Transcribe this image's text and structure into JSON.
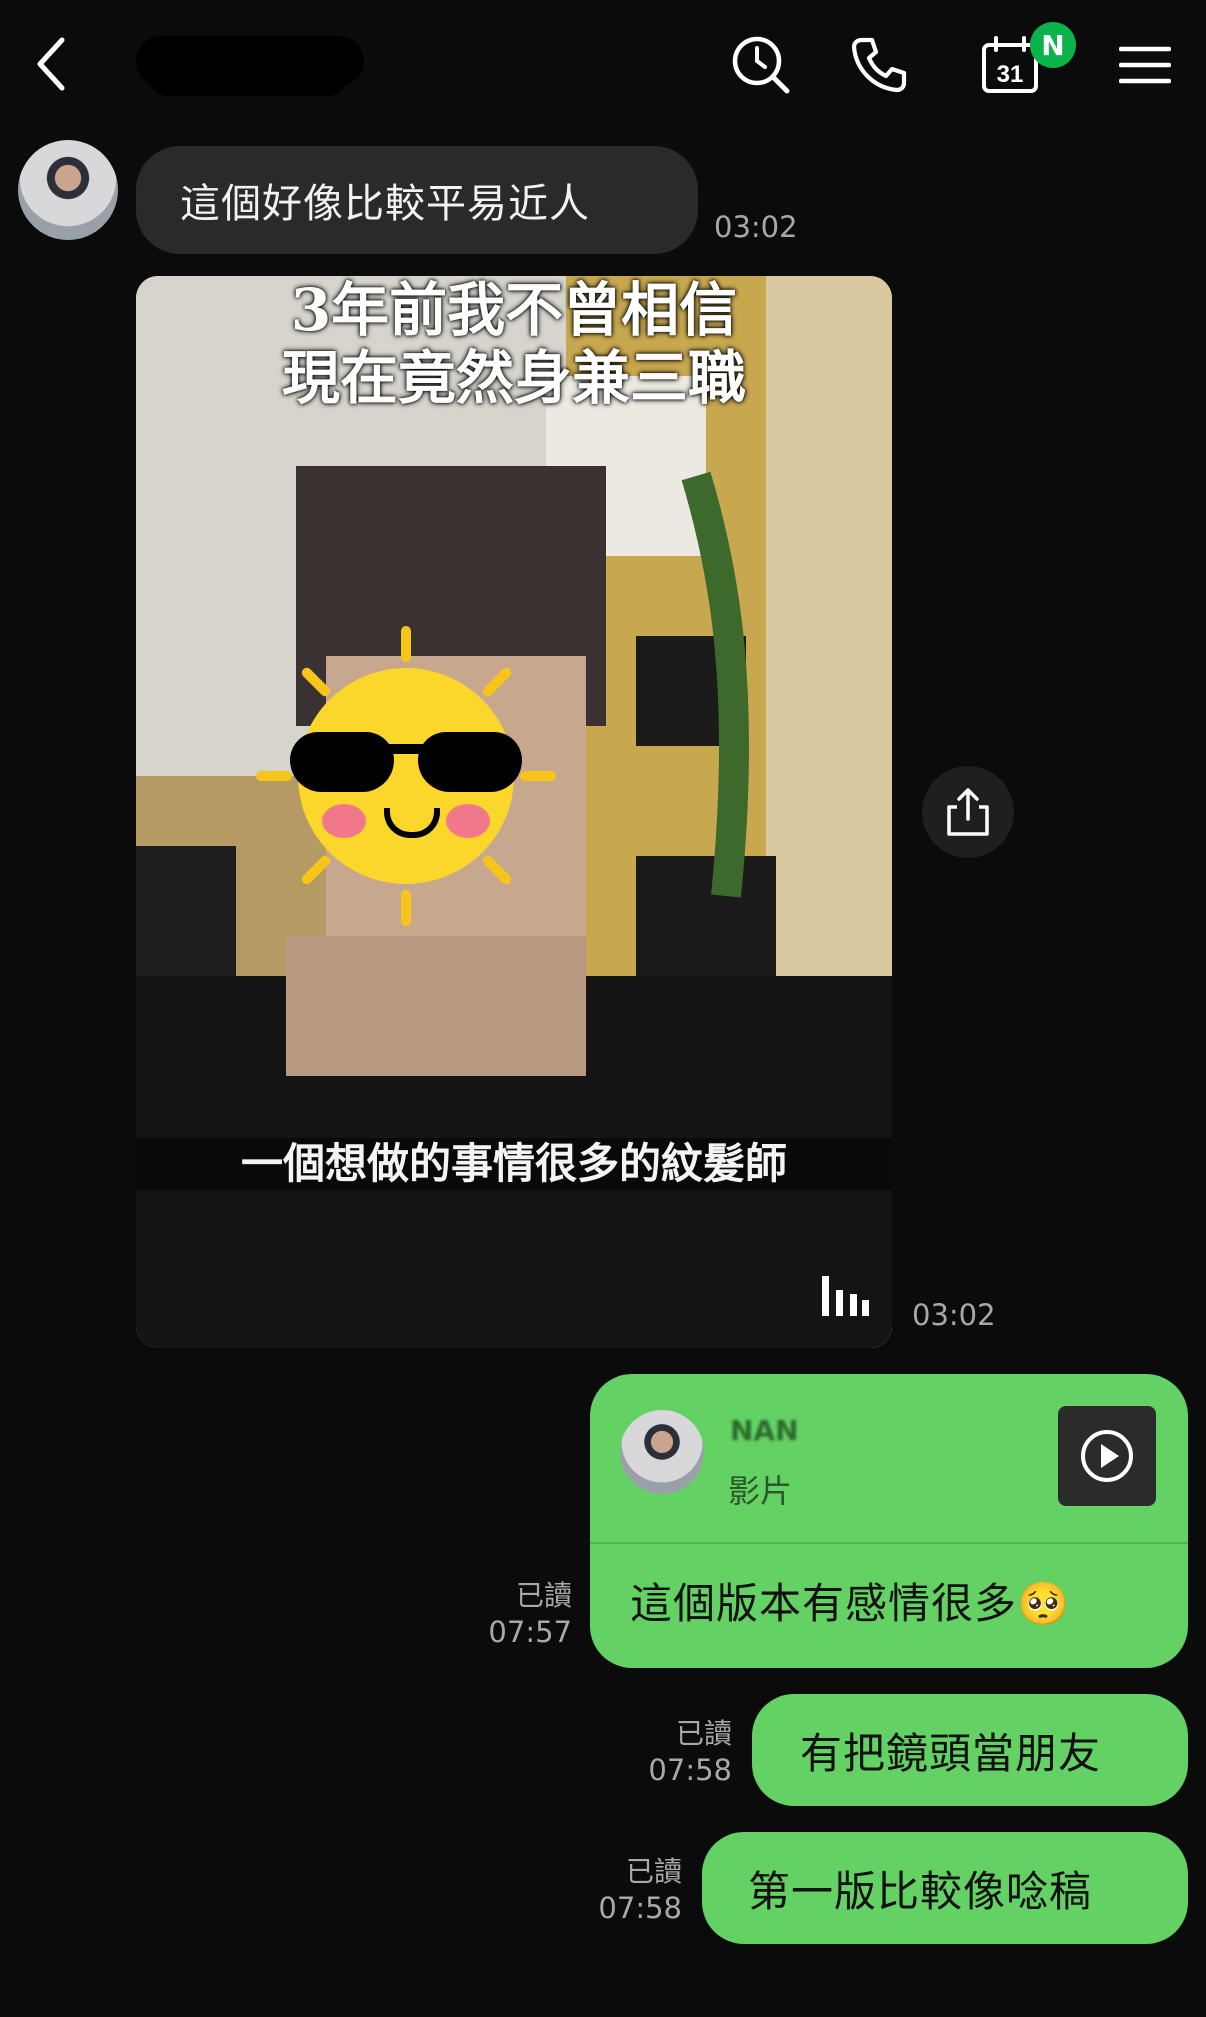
{
  "header": {
    "back_icon": "chevron-left-icon",
    "contact_name_redacted": true,
    "search_icon": "search-clock-icon",
    "call_icon": "phone-icon",
    "calendar_day": "31",
    "calendar_badge": "N",
    "menu_icon": "hamburger-menu-icon",
    "badge_color": "#0ab44a"
  },
  "messages": {
    "m1": {
      "text": "這個好像比較平易近人",
      "time": "03:02"
    },
    "video": {
      "title_line1": "3年前我不曾相信",
      "title_line2": "現在竟然身兼三職",
      "subtitle": "一個想做的事情很多的紋髮師",
      "time": "03:02",
      "share_icon": "share-icon",
      "sound_icon": "audio-bars-icon"
    },
    "reply": {
      "quoted_sender": "NAN",
      "quoted_type": "影片",
      "text": "這個版本有感情很多🥺",
      "read": "已讀",
      "time": "07:57"
    },
    "m3": {
      "text": "有把鏡頭當朋友",
      "read": "已讀",
      "time": "07:58"
    },
    "m4": {
      "text": "第一版比較像唸稿",
      "read": "已讀",
      "time": "07:58"
    }
  },
  "colors": {
    "background": "#0b0b0c",
    "incoming_bubble": "#2a2a2c",
    "outgoing_bubble": "#63d163"
  }
}
